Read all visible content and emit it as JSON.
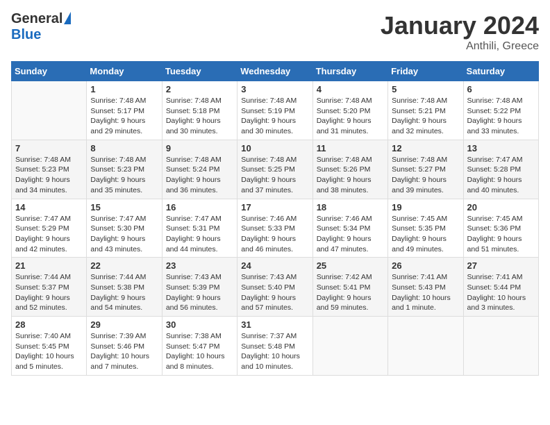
{
  "header": {
    "logo_general": "General",
    "logo_blue": "Blue",
    "month_title": "January 2024",
    "location": "Anthili, Greece"
  },
  "weekdays": [
    "Sunday",
    "Monday",
    "Tuesday",
    "Wednesday",
    "Thursday",
    "Friday",
    "Saturday"
  ],
  "weeks": [
    [
      {
        "day": "",
        "sunrise": "",
        "sunset": "",
        "daylight": ""
      },
      {
        "day": "1",
        "sunrise": "Sunrise: 7:48 AM",
        "sunset": "Sunset: 5:17 PM",
        "daylight": "Daylight: 9 hours and 29 minutes."
      },
      {
        "day": "2",
        "sunrise": "Sunrise: 7:48 AM",
        "sunset": "Sunset: 5:18 PM",
        "daylight": "Daylight: 9 hours and 30 minutes."
      },
      {
        "day": "3",
        "sunrise": "Sunrise: 7:48 AM",
        "sunset": "Sunset: 5:19 PM",
        "daylight": "Daylight: 9 hours and 30 minutes."
      },
      {
        "day": "4",
        "sunrise": "Sunrise: 7:48 AM",
        "sunset": "Sunset: 5:20 PM",
        "daylight": "Daylight: 9 hours and 31 minutes."
      },
      {
        "day": "5",
        "sunrise": "Sunrise: 7:48 AM",
        "sunset": "Sunset: 5:21 PM",
        "daylight": "Daylight: 9 hours and 32 minutes."
      },
      {
        "day": "6",
        "sunrise": "Sunrise: 7:48 AM",
        "sunset": "Sunset: 5:22 PM",
        "daylight": "Daylight: 9 hours and 33 minutes."
      }
    ],
    [
      {
        "day": "7",
        "sunrise": "Sunrise: 7:48 AM",
        "sunset": "Sunset: 5:23 PM",
        "daylight": "Daylight: 9 hours and 34 minutes."
      },
      {
        "day": "8",
        "sunrise": "Sunrise: 7:48 AM",
        "sunset": "Sunset: 5:23 PM",
        "daylight": "Daylight: 9 hours and 35 minutes."
      },
      {
        "day": "9",
        "sunrise": "Sunrise: 7:48 AM",
        "sunset": "Sunset: 5:24 PM",
        "daylight": "Daylight: 9 hours and 36 minutes."
      },
      {
        "day": "10",
        "sunrise": "Sunrise: 7:48 AM",
        "sunset": "Sunset: 5:25 PM",
        "daylight": "Daylight: 9 hours and 37 minutes."
      },
      {
        "day": "11",
        "sunrise": "Sunrise: 7:48 AM",
        "sunset": "Sunset: 5:26 PM",
        "daylight": "Daylight: 9 hours and 38 minutes."
      },
      {
        "day": "12",
        "sunrise": "Sunrise: 7:48 AM",
        "sunset": "Sunset: 5:27 PM",
        "daylight": "Daylight: 9 hours and 39 minutes."
      },
      {
        "day": "13",
        "sunrise": "Sunrise: 7:47 AM",
        "sunset": "Sunset: 5:28 PM",
        "daylight": "Daylight: 9 hours and 40 minutes."
      }
    ],
    [
      {
        "day": "14",
        "sunrise": "Sunrise: 7:47 AM",
        "sunset": "Sunset: 5:29 PM",
        "daylight": "Daylight: 9 hours and 42 minutes."
      },
      {
        "day": "15",
        "sunrise": "Sunrise: 7:47 AM",
        "sunset": "Sunset: 5:30 PM",
        "daylight": "Daylight: 9 hours and 43 minutes."
      },
      {
        "day": "16",
        "sunrise": "Sunrise: 7:47 AM",
        "sunset": "Sunset: 5:31 PM",
        "daylight": "Daylight: 9 hours and 44 minutes."
      },
      {
        "day": "17",
        "sunrise": "Sunrise: 7:46 AM",
        "sunset": "Sunset: 5:33 PM",
        "daylight": "Daylight: 9 hours and 46 minutes."
      },
      {
        "day": "18",
        "sunrise": "Sunrise: 7:46 AM",
        "sunset": "Sunset: 5:34 PM",
        "daylight": "Daylight: 9 hours and 47 minutes."
      },
      {
        "day": "19",
        "sunrise": "Sunrise: 7:45 AM",
        "sunset": "Sunset: 5:35 PM",
        "daylight": "Daylight: 9 hours and 49 minutes."
      },
      {
        "day": "20",
        "sunrise": "Sunrise: 7:45 AM",
        "sunset": "Sunset: 5:36 PM",
        "daylight": "Daylight: 9 hours and 51 minutes."
      }
    ],
    [
      {
        "day": "21",
        "sunrise": "Sunrise: 7:44 AM",
        "sunset": "Sunset: 5:37 PM",
        "daylight": "Daylight: 9 hours and 52 minutes."
      },
      {
        "day": "22",
        "sunrise": "Sunrise: 7:44 AM",
        "sunset": "Sunset: 5:38 PM",
        "daylight": "Daylight: 9 hours and 54 minutes."
      },
      {
        "day": "23",
        "sunrise": "Sunrise: 7:43 AM",
        "sunset": "Sunset: 5:39 PM",
        "daylight": "Daylight: 9 hours and 56 minutes."
      },
      {
        "day": "24",
        "sunrise": "Sunrise: 7:43 AM",
        "sunset": "Sunset: 5:40 PM",
        "daylight": "Daylight: 9 hours and 57 minutes."
      },
      {
        "day": "25",
        "sunrise": "Sunrise: 7:42 AM",
        "sunset": "Sunset: 5:41 PM",
        "daylight": "Daylight: 9 hours and 59 minutes."
      },
      {
        "day": "26",
        "sunrise": "Sunrise: 7:41 AM",
        "sunset": "Sunset: 5:43 PM",
        "daylight": "Daylight: 10 hours and 1 minute."
      },
      {
        "day": "27",
        "sunrise": "Sunrise: 7:41 AM",
        "sunset": "Sunset: 5:44 PM",
        "daylight": "Daylight: 10 hours and 3 minutes."
      }
    ],
    [
      {
        "day": "28",
        "sunrise": "Sunrise: 7:40 AM",
        "sunset": "Sunset: 5:45 PM",
        "daylight": "Daylight: 10 hours and 5 minutes."
      },
      {
        "day": "29",
        "sunrise": "Sunrise: 7:39 AM",
        "sunset": "Sunset: 5:46 PM",
        "daylight": "Daylight: 10 hours and 7 minutes."
      },
      {
        "day": "30",
        "sunrise": "Sunrise: 7:38 AM",
        "sunset": "Sunset: 5:47 PM",
        "daylight": "Daylight: 10 hours and 8 minutes."
      },
      {
        "day": "31",
        "sunrise": "Sunrise: 7:37 AM",
        "sunset": "Sunset: 5:48 PM",
        "daylight": "Daylight: 10 hours and 10 minutes."
      },
      {
        "day": "",
        "sunrise": "",
        "sunset": "",
        "daylight": ""
      },
      {
        "day": "",
        "sunrise": "",
        "sunset": "",
        "daylight": ""
      },
      {
        "day": "",
        "sunrise": "",
        "sunset": "",
        "daylight": ""
      }
    ]
  ]
}
